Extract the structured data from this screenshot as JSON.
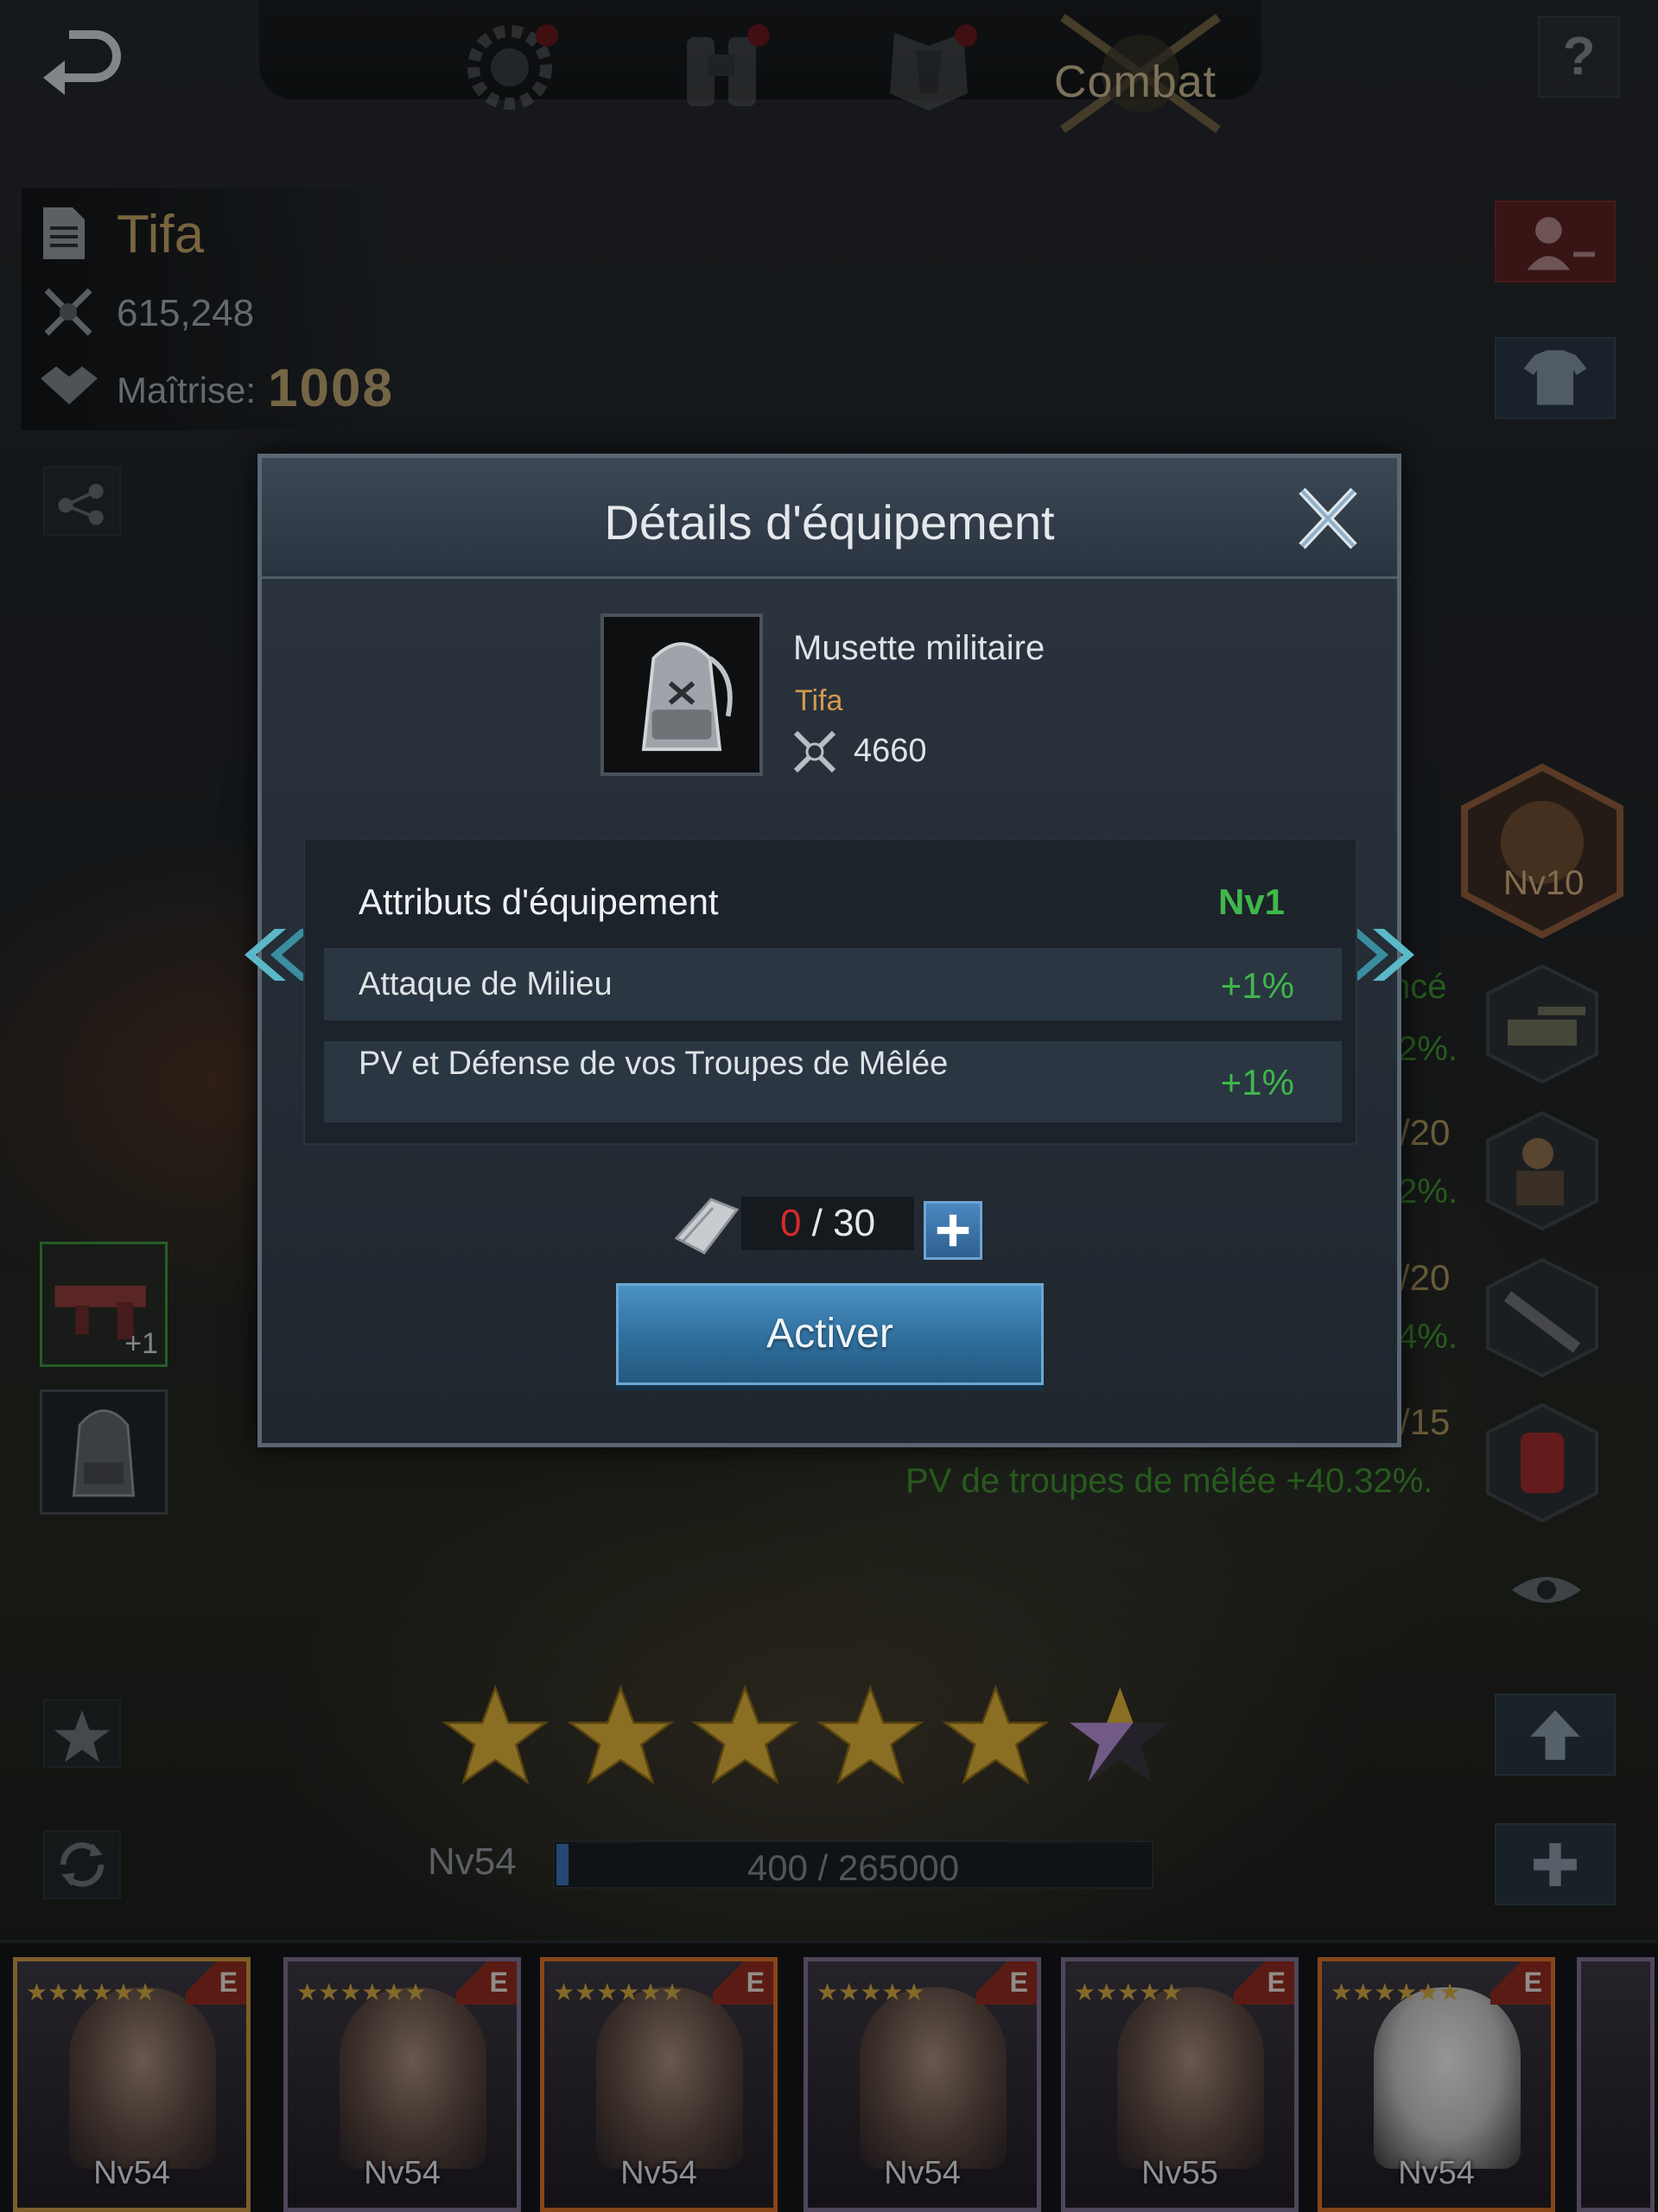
{
  "topnav": {
    "combat_label": "Combat",
    "help_label": "?"
  },
  "hero": {
    "name": "Tifa",
    "power": "615,248",
    "mastery_label": "Maîtrise:",
    "mastery_value": "1008",
    "level": "Nv54",
    "xp": "400 / 265000",
    "xp_progress": 0.0015,
    "stars_full": 5,
    "stars_partial": 1
  },
  "equipment_slots": [
    {
      "plus": "+1"
    },
    {
      "plus": ""
    }
  ],
  "skills": {
    "rank_level": "Nv10",
    "rows": [
      {
        "text": "ncé",
        "sub": "2%.",
        "level": ""
      },
      {
        "text": "",
        "sub": "2%.",
        "level": "/20"
      },
      {
        "text": "",
        "sub": "4%.",
        "level": "/20"
      },
      {
        "text": "PV de troupes de mêlée +40.32%.",
        "sub": "",
        "level": "/15"
      }
    ]
  },
  "modal": {
    "title": "Détails d'équipement",
    "item": {
      "name": "Musette militaire",
      "owner": "Tifa",
      "power": "4660"
    },
    "attributes": {
      "title": "Attributs d'équipement",
      "level": "Nv1",
      "rows": [
        {
          "name": "Attaque de Milieu",
          "value": "+1%"
        },
        {
          "name": "PV et Défense de vos Troupes de Mêlée",
          "value": "+1%"
        }
      ]
    },
    "material": {
      "current": "0",
      "separator": " / ",
      "max": "30"
    },
    "activate_label": "Activer"
  },
  "roster": [
    {
      "level": "Nv54",
      "badge": "E",
      "stars": "★★★★★★"
    },
    {
      "level": "Nv54",
      "badge": "E",
      "stars": "★★★★★★"
    },
    {
      "level": "Nv54",
      "badge": "E",
      "stars": "★★★★★★"
    },
    {
      "level": "Nv54",
      "badge": "E",
      "stars": "★★★★★"
    },
    {
      "level": "Nv55",
      "badge": "E",
      "stars": "★★★★★"
    },
    {
      "level": "Nv54",
      "badge": "E",
      "stars": "★★★★★★"
    }
  ],
  "colors": {
    "accent_gold": "#b89b5e",
    "positive_green": "#3fb84a",
    "danger_red": "#d82a2a",
    "button_blue": "#2f6e9c"
  }
}
